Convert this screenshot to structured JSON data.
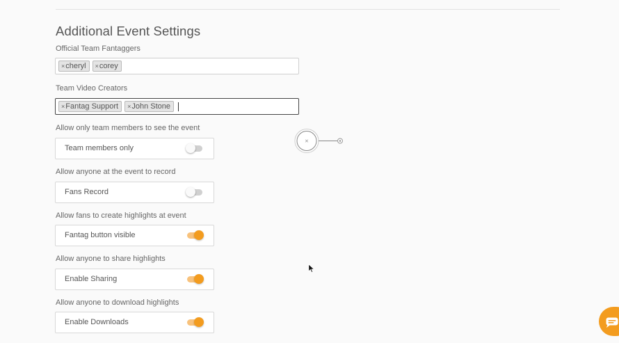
{
  "section": {
    "title": "Additional Event Settings"
  },
  "fantaggers": {
    "label": "Official Team Fantaggers",
    "tags": [
      "cheryl",
      "corey"
    ]
  },
  "video_creators": {
    "label": "Team Video Creators",
    "tags": [
      "Fantag Support",
      "John Stone"
    ]
  },
  "settings": [
    {
      "description": "Allow only team members to see the event",
      "toggle_label": "Team members only",
      "enabled": false
    },
    {
      "description": "Allow anyone at the event to record",
      "toggle_label": "Fans Record",
      "enabled": false
    },
    {
      "description": "Allow fans to create highlights at event",
      "toggle_label": "Fantag button visible",
      "enabled": true
    },
    {
      "description": "Allow anyone to share highlights",
      "toggle_label": "Enable Sharing",
      "enabled": true
    },
    {
      "description": "Allow anyone to download highlights",
      "toggle_label": "Enable Downloads",
      "enabled": true
    }
  ],
  "tag_remove_symbol": "×",
  "colors": {
    "accent": "#f39c1f",
    "accent_track": "#f8c27c",
    "off_track": "#d0d0d0"
  },
  "icons": {
    "chat": "chat-bubble-icon",
    "cursor": "mouse-pointer-icon",
    "target": "target-handle-icon"
  }
}
